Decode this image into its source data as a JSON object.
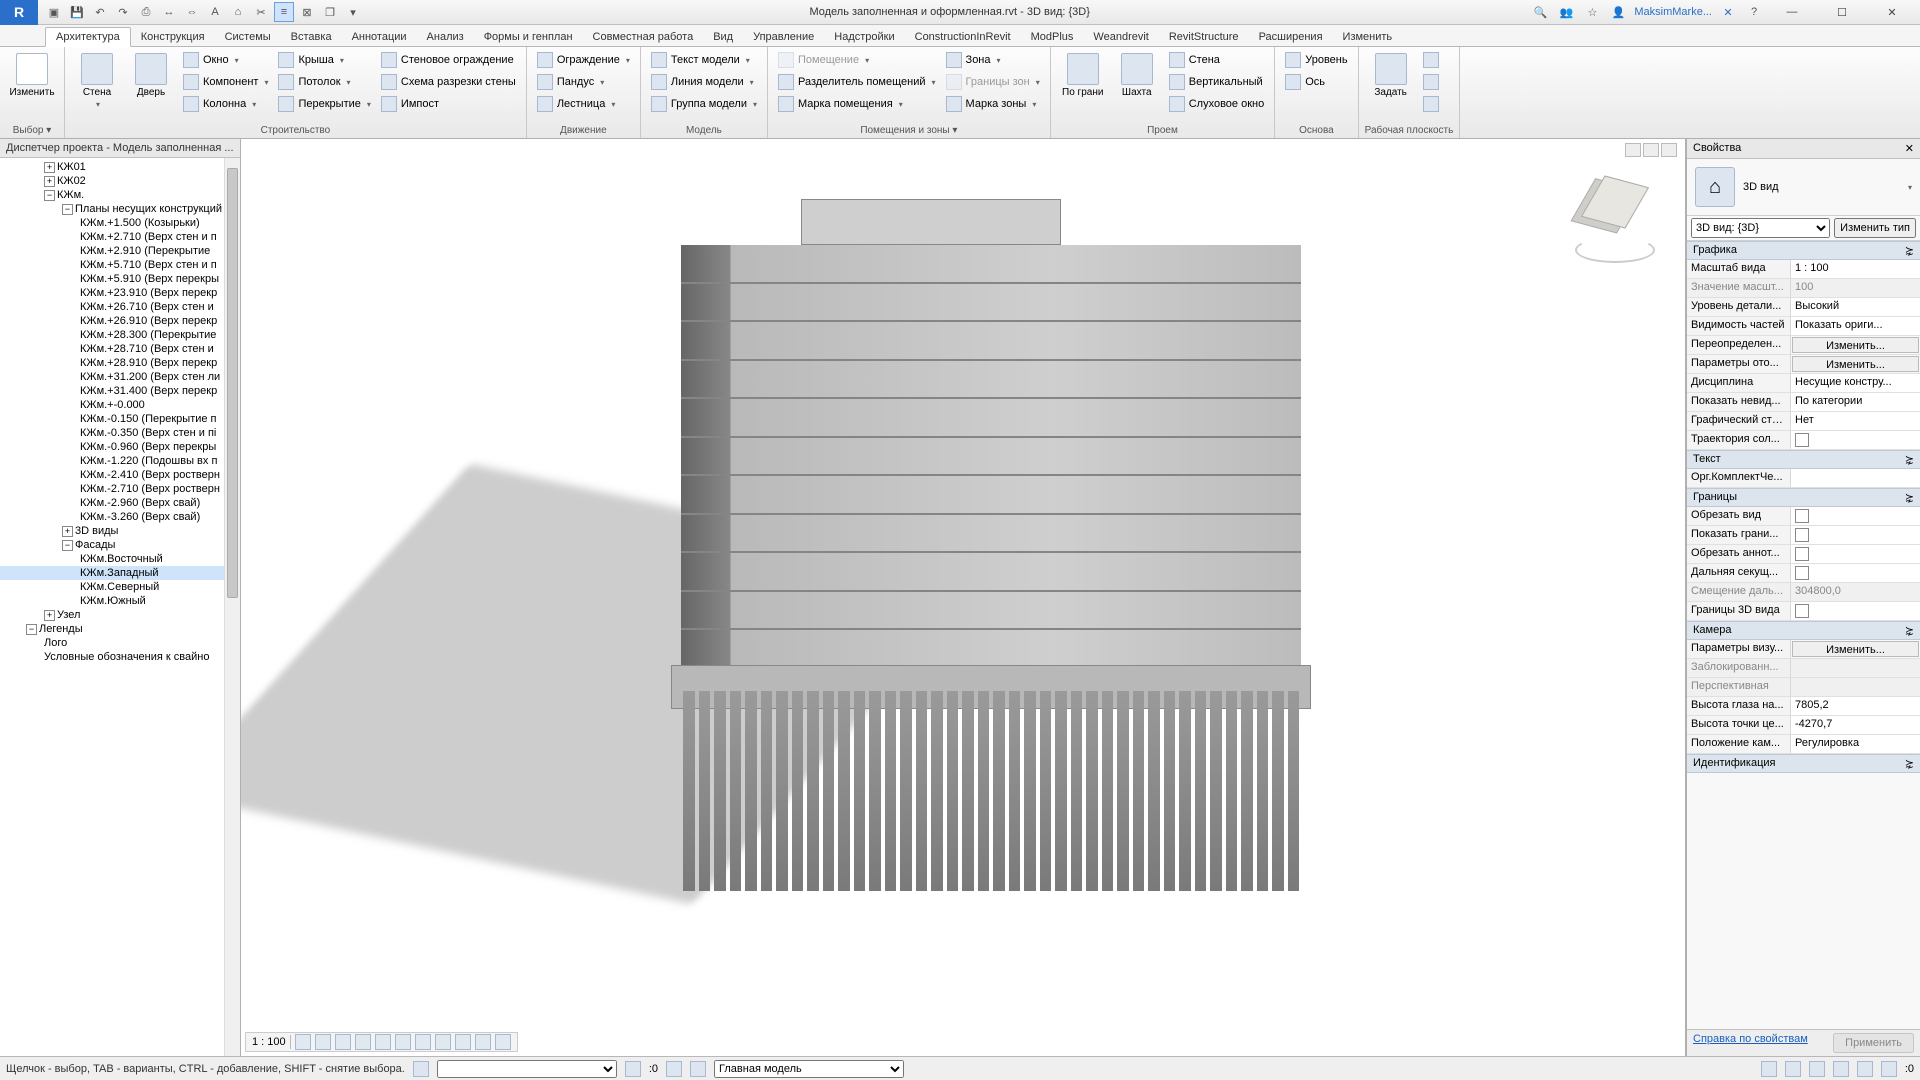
{
  "title": "Модель заполненная и оформленная.rvt - 3D вид: {3D}",
  "user": "MaksimMarke...",
  "ribbonTabs": [
    "Архитектура",
    "Конструкция",
    "Системы",
    "Вставка",
    "Аннотации",
    "Анализ",
    "Формы и генплан",
    "Совместная работа",
    "Вид",
    "Управление",
    "Надстройки",
    "ConstructionInRevit",
    "ModPlus",
    "Weandrevit",
    "RevitStructure",
    "Расширения",
    "Изменить"
  ],
  "activeTab": 0,
  "groups": {
    "select": {
      "label": "Выбор ▾",
      "btn": "Изменить"
    },
    "build": {
      "label": "Строительство",
      "big": [
        {
          "l": "Стена"
        },
        {
          "l": "Дверь"
        }
      ],
      "col1": [
        "Окно",
        "Компонент",
        "Колонна"
      ],
      "col2": [
        "Крыша",
        "Потолок",
        "Перекрытие"
      ],
      "col3": [
        "Стеновое ограждение",
        "Схема разрезки стены",
        "Импост"
      ]
    },
    "motion": {
      "label": "Движение",
      "items": [
        "Ограждение",
        "Пандус",
        "Лестница"
      ]
    },
    "model": {
      "label": "Модель",
      "items": [
        "Текст модели",
        "Линия  модели",
        "Группа модели"
      ]
    },
    "rooms": {
      "label": "Помещения и зоны ▾",
      "col1": [
        "Помещение",
        "Разделитель помещений",
        "Марка помещения"
      ],
      "col2": [
        "Зона",
        "Границы  зон",
        "Марка  зоны"
      ]
    },
    "opening": {
      "label": "Проем",
      "big": [
        {
          "l": "По грани"
        },
        {
          "l": "Шахта"
        }
      ],
      "col": [
        "Стена",
        "Вертикальный",
        "Слуховое окно"
      ]
    },
    "datum": {
      "label": "Основа",
      "big": [
        {
          "l": "Задать"
        }
      ],
      "col": [
        "Уровень",
        "Ось"
      ]
    },
    "workplane": {
      "label": "Рабочая плоскость"
    }
  },
  "projectBrowser": {
    "title": "Диспетчер проекта - Модель заполненная ...",
    "tree": [
      {
        "t": "КЖ01",
        "lvl": 1,
        "exp": "+"
      },
      {
        "t": "КЖ02",
        "lvl": 1,
        "exp": "+"
      },
      {
        "t": "КЖм.",
        "lvl": 1,
        "exp": "-"
      },
      {
        "t": "Планы несущих конструкций",
        "lvl": 2,
        "exp": "-"
      },
      {
        "t": "КЖм.+1.500 (Козырьки)",
        "lvl": 3
      },
      {
        "t": "КЖм.+2.710 (Верх стен и п",
        "lvl": 3
      },
      {
        "t": "КЖм.+2.910 (Перекрытие",
        "lvl": 3
      },
      {
        "t": "КЖм.+5.710 (Верх стен и п",
        "lvl": 3
      },
      {
        "t": "КЖм.+5.910 (Верх перекры",
        "lvl": 3
      },
      {
        "t": "КЖм.+23.910 (Верх перекр",
        "lvl": 3
      },
      {
        "t": "КЖм.+26.710 (Верх стен и",
        "lvl": 3
      },
      {
        "t": "КЖм.+26.910 (Верх перекр",
        "lvl": 3
      },
      {
        "t": "КЖм.+28.300 (Перекрытие",
        "lvl": 3
      },
      {
        "t": "КЖм.+28.710 (Верх стен и",
        "lvl": 3
      },
      {
        "t": "КЖм.+28.910 (Верх перекр",
        "lvl": 3
      },
      {
        "t": "КЖм.+31.200 (Верх стен ли",
        "lvl": 3
      },
      {
        "t": "КЖм.+31.400 (Верх перекр",
        "lvl": 3
      },
      {
        "t": "КЖм.+-0.000",
        "lvl": 3
      },
      {
        "t": "КЖм.-0.150 (Перекрытие п",
        "lvl": 3
      },
      {
        "t": "КЖм.-0.350 (Верх стен и пі",
        "lvl": 3
      },
      {
        "t": "КЖм.-0.960 (Верх перекры",
        "lvl": 3
      },
      {
        "t": "КЖм.-1.220 (Подошвы вх п",
        "lvl": 3
      },
      {
        "t": "КЖм.-2.410 (Верх ростверн",
        "lvl": 3
      },
      {
        "t": "КЖм.-2.710 (Верх ростверн",
        "lvl": 3
      },
      {
        "t": "КЖм.-2.960 (Верх свай)",
        "lvl": 3
      },
      {
        "t": "КЖм.-3.260 (Верх свай)",
        "lvl": 3
      },
      {
        "t": "3D виды",
        "lvl": 2,
        "exp": "+"
      },
      {
        "t": "Фасады",
        "lvl": 2,
        "exp": "-"
      },
      {
        "t": "КЖм.Восточный",
        "lvl": 3
      },
      {
        "t": "КЖм.Западный",
        "lvl": 3,
        "sel": true
      },
      {
        "t": "КЖм.Северный",
        "lvl": 3
      },
      {
        "t": "КЖм.Южный",
        "lvl": 3
      },
      {
        "t": "Узел",
        "lvl": 1,
        "exp": "+"
      },
      {
        "t": "Легенды",
        "lvl": 0,
        "exp": "-"
      },
      {
        "t": "Лого",
        "lvl": 1
      },
      {
        "t": "Условные обозначения к свайно",
        "lvl": 1
      }
    ]
  },
  "viewScale": "1 : 100",
  "properties": {
    "title": "Свойства",
    "typeName": "3D вид",
    "selector": "3D вид: {3D}",
    "editType": "Изменить тип",
    "groups": [
      {
        "h": "Графика",
        "rows": [
          {
            "n": "Масштаб вида",
            "v": "1 : 100"
          },
          {
            "n": "Значение масшт...",
            "v": "100",
            "ro": true
          },
          {
            "n": "Уровень детали...",
            "v": "Высокий"
          },
          {
            "n": "Видимость частей",
            "v": "Показать ориги..."
          },
          {
            "n": "Переопределен...",
            "btn": "Изменить..."
          },
          {
            "n": "Параметры ото...",
            "btn": "Изменить..."
          },
          {
            "n": "Дисциплина",
            "v": "Несущие констру..."
          },
          {
            "n": "Показать невид...",
            "v": "По категории"
          },
          {
            "n": "Графический сти...",
            "v": "Нет"
          },
          {
            "n": "Траектория сол...",
            "chk": true
          }
        ]
      },
      {
        "h": "Текст",
        "rows": [
          {
            "n": "Орг.КомплектЧе...",
            "v": ""
          }
        ]
      },
      {
        "h": "Границы",
        "rows": [
          {
            "n": "Обрезать вид",
            "chk": true
          },
          {
            "n": "Показать грани...",
            "chk": true
          },
          {
            "n": "Обрезать аннот...",
            "chk": true
          },
          {
            "n": "Дальняя секущ...",
            "chk": true
          },
          {
            "n": "Смещение даль...",
            "v": "304800,0",
            "ro": true
          },
          {
            "n": "Границы 3D вида",
            "chk": true
          }
        ]
      },
      {
        "h": "Камера",
        "rows": [
          {
            "n": "Параметры визу...",
            "btn": "Изменить..."
          },
          {
            "n": "Заблокированн...",
            "v": "",
            "ro": true
          },
          {
            "n": "Перспективная",
            "v": "",
            "ro": true
          },
          {
            "n": "Высота глаза на...",
            "v": "7805,2"
          },
          {
            "n": "Высота точки це...",
            "v": "-4270,7"
          },
          {
            "n": "Положение кам...",
            "v": "Регулировка"
          }
        ]
      },
      {
        "h": "Идентификация",
        "rows": []
      }
    ],
    "helpLink": "Справка по свойствам",
    "apply": "Применить"
  },
  "statusText": "Щелчок - выбор, TAB - варианты, CTRL - добавление, SHIFT - снятие выбора.",
  "statusModel": "Главная модель",
  "statusZero": ":0",
  "statusSel": ":0"
}
